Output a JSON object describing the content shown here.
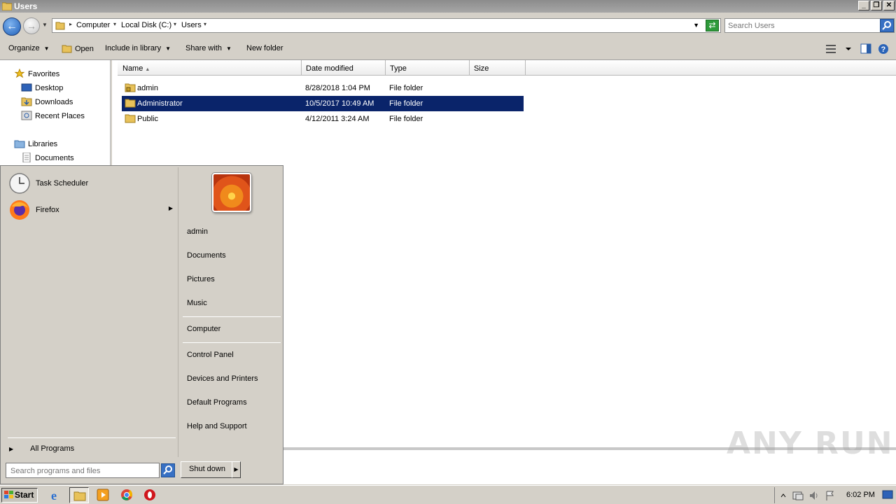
{
  "window": {
    "title": "Users",
    "minimize": "_",
    "restore": "❐",
    "close": "✕"
  },
  "address": {
    "breadcrumbs": [
      "Computer",
      "Local Disk (C:)",
      "Users"
    ],
    "search_placeholder": "Search Users"
  },
  "toolbar": {
    "organize": "Organize",
    "open": "Open",
    "include_in_library": "Include in library",
    "share_with": "Share with",
    "new_folder": "New folder"
  },
  "nav": {
    "favorites": "Favorites",
    "desktop": "Desktop",
    "downloads": "Downloads",
    "recent_places": "Recent Places",
    "libraries": "Libraries",
    "documents": "Documents"
  },
  "columns": [
    "Name",
    "Date modified",
    "Type",
    "Size"
  ],
  "files": [
    {
      "name": "admin",
      "date": "8/28/2018 1:04 PM",
      "type": "File folder",
      "size": "",
      "selected": false
    },
    {
      "name": "Administrator",
      "date": "10/5/2017 10:49 AM",
      "type": "File folder",
      "size": "",
      "selected": true
    },
    {
      "name": "Public",
      "date": "4/12/2011 3:24 AM",
      "type": "File folder",
      "size": "",
      "selected": false
    }
  ],
  "start_menu": {
    "pinned": [
      {
        "label": "Task Scheduler",
        "icon": "clock-icon"
      },
      {
        "label": "Firefox",
        "icon": "firefox-icon"
      }
    ],
    "all_programs": "All Programs",
    "search_placeholder": "Search programs and files",
    "right_links": [
      "admin",
      "Documents",
      "Pictures",
      "Music",
      "Computer",
      "Control Panel",
      "Devices and Printers",
      "Default Programs",
      "Help and Support"
    ],
    "shutdown": "Shut down"
  },
  "taskbar": {
    "start": "Start",
    "clock": "6:02 PM"
  },
  "watermark": "ANY RUN",
  "colors": {
    "selection": "#0a246a",
    "chrome": "#d4d0c8"
  }
}
